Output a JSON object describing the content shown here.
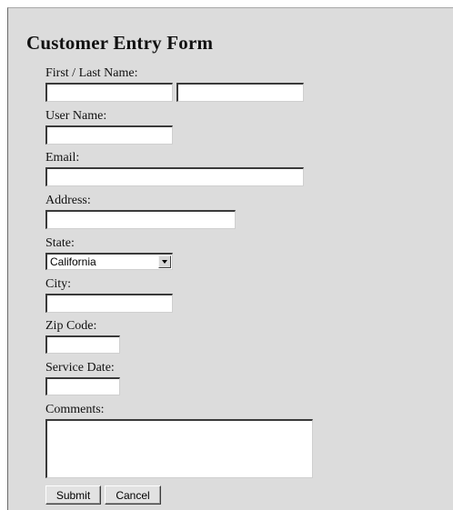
{
  "form": {
    "title": "Customer Entry Form",
    "labels": {
      "name": "First / Last Name:",
      "username": "User Name:",
      "email": "Email:",
      "address": "Address:",
      "state": "State:",
      "city": "City:",
      "zip": "Zip Code:",
      "service_date": "Service Date:",
      "comments": "Comments:"
    },
    "values": {
      "first_name": "",
      "last_name": "",
      "username": "",
      "email": "",
      "address": "",
      "city": "",
      "zip": "",
      "service_date": "",
      "comments": ""
    },
    "state_selected": "California",
    "buttons": {
      "submit": "Submit",
      "cancel": "Cancel"
    }
  }
}
